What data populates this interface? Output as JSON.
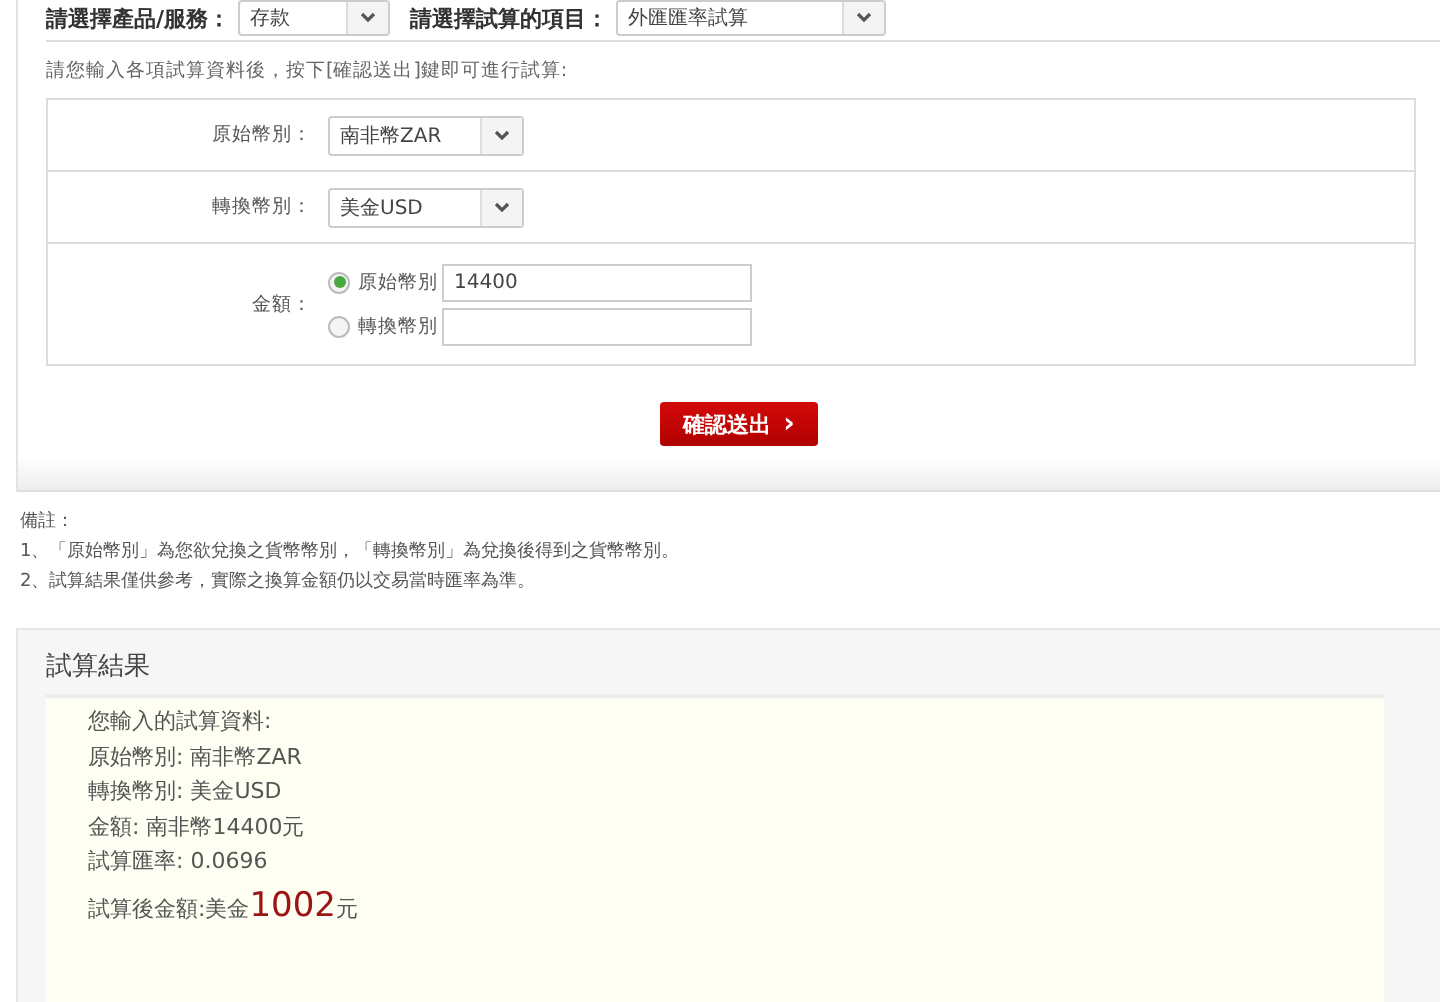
{
  "filters": [
    {
      "label": "請選擇產品/服務：",
      "value": "存款"
    },
    {
      "label": "請選擇試算的項目：",
      "value": "外匯匯率試算"
    }
  ],
  "instruction": "請您輸入各項試算資料後，按下[確認送出]鍵即可進行試算:",
  "form": {
    "rows": [
      {
        "kind": "select",
        "label": "原始幣別：",
        "value": "南非幣ZAR"
      },
      {
        "kind": "select",
        "label": "轉換幣別：",
        "value": "美金USD"
      },
      {
        "kind": "amount",
        "label": "金額：",
        "options": [
          {
            "label": "原始幣別",
            "value": "14400",
            "selected": true
          },
          {
            "label": "轉換幣別",
            "selected": false
          }
        ]
      }
    ]
  },
  "submit_button": "確認送出",
  "submit_icon": "›",
  "notes": {
    "title": "備註：",
    "items": [
      "1、「原始幣別」為您欲兌換之貨幣幣別，「轉換幣別」為兌換後得到之貨幣幣別。",
      "2、試算結果僅供參考，實際之換算金額仍以交易當時匯率為準。"
    ]
  },
  "result": {
    "title": "試算結果",
    "lines": [
      "您輸入的試算資料:",
      "原始幣別: 南非幣ZAR",
      "轉換幣別: 美金USD",
      "金額: 南非幣14400元",
      "試算匯率: 0.0696"
    ],
    "total": {
      "label": "試算後金額:美金",
      "amount": "1002",
      "unit": "元"
    }
  }
}
